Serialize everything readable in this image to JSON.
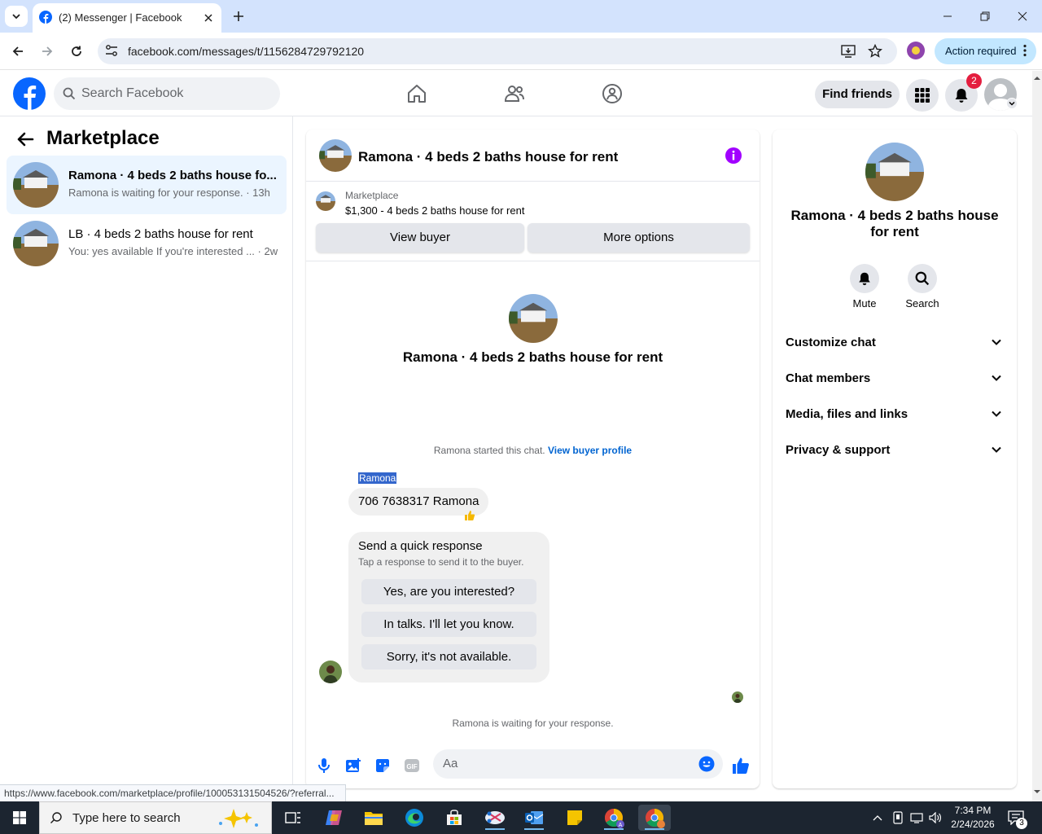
{
  "browser": {
    "tab_title": "(2) Messenger | Facebook",
    "url": "facebook.com/messages/t/1156284729792120",
    "action_required": "Action required",
    "status_url": "https://www.facebook.com/marketplace/profile/100053131504526/?referral..."
  },
  "fb": {
    "search_placeholder": "Search Facebook",
    "find_friends": "Find friends",
    "notification_count": "2",
    "brand_color": "#0866ff"
  },
  "sidebar": {
    "title": "Marketplace",
    "conversations": [
      {
        "title": "Ramona · 4 beds 2 baths house fo...",
        "subtitle": "Ramona is waiting for your response. · 13h",
        "active": true
      },
      {
        "title": "LB · 4 beds 2 baths house for rent",
        "subtitle": "You: yes available If you're interested ... · 2w",
        "active": false
      }
    ]
  },
  "chat": {
    "title": "Ramona · 4 beds 2 baths house for rent",
    "listing_label": "Marketplace",
    "listing_price": "$1,300 - 4 beds 2 baths house for rent",
    "view_buyer": "View buyer",
    "more_options": "More options",
    "intro_title": "Ramona · 4 beds 2 baths house for rent",
    "started_text": "Ramona started this chat.",
    "view_buyer_profile": "View buyer profile",
    "sender": "Ramona",
    "message": "706 7638317 Ramona",
    "quick_title": "Send a quick response",
    "quick_subtitle": "Tap a response to send it to the buyer.",
    "quick_replies": [
      "Yes, are you interested?",
      "In talks. I'll let you know.",
      "Sorry, it's not available."
    ],
    "waiting": "Ramona is waiting for your response.",
    "composer_placeholder": "Aa"
  },
  "details": {
    "title": "Ramona · 4 beds 2 baths house for rent",
    "mute": "Mute",
    "search": "Search",
    "sections": [
      "Customize chat",
      "Chat members",
      "Media, files and links",
      "Privacy & support"
    ]
  },
  "taskbar": {
    "search_placeholder": "Type here to search",
    "time": "7:34 PM",
    "date": "2/24/2026",
    "notification_count": "3"
  }
}
